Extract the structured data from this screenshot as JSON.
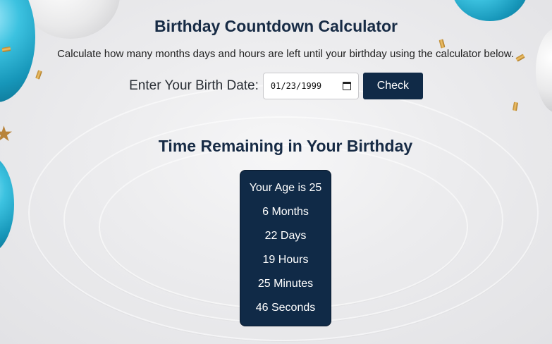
{
  "header": {
    "title": "Birthday Countdown Calculator",
    "subtitle": "Calculate how many months days and hours are left until your birthday using the calculator below."
  },
  "form": {
    "label": "Enter Your Birth Date:",
    "date_value": "01/23/1999",
    "check_label": "Check"
  },
  "results": {
    "title": "Time Remaining in Your Birthday",
    "age": "Your Age is 25",
    "months": "6 Months",
    "days": "22 Days",
    "hours": "19 Hours",
    "minutes": "25 Minutes",
    "seconds": "46 Seconds"
  },
  "icons": {
    "date_picker": "calendar-icon"
  },
  "colors": {
    "accent": "#102a47",
    "heading": "#172b45",
    "balloon_blue": "#1696b9",
    "confetti_gold": "#c9963f"
  }
}
